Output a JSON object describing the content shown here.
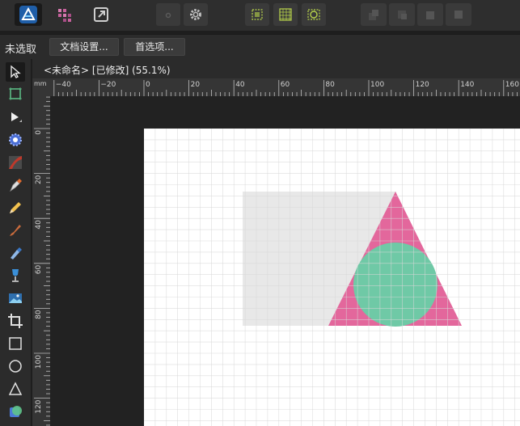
{
  "context_bar": {
    "selection_status": "未选取",
    "document_setup_label": "文档设置...",
    "preferences_label": "首选项..."
  },
  "document": {
    "tab_title": "<未命名> [已修改] (55.1%)"
  },
  "rulers": {
    "unit": "mm",
    "horizontal_labels": [
      "−40",
      "−20",
      "0",
      "20",
      "40",
      "60",
      "80",
      "100",
      "120",
      "140",
      "160"
    ],
    "vertical_labels": [
      "0",
      "20",
      "40",
      "60",
      "80",
      "100",
      "120"
    ]
  },
  "colors": {
    "app_accent": "#3a8fd8",
    "triangle_fill": "#e3679c",
    "circle_fill": "#6fc9a6",
    "rectangle_fill": "#e8e8e8",
    "grid_line": "#d8d8d8",
    "snap_icon": "#b8d44a"
  },
  "icons": {
    "app": "affinity-designer-icon",
    "persona_pixel": "pixel-persona-icon",
    "persona_export": "export-persona-icon",
    "settings": "gear-icon"
  }
}
